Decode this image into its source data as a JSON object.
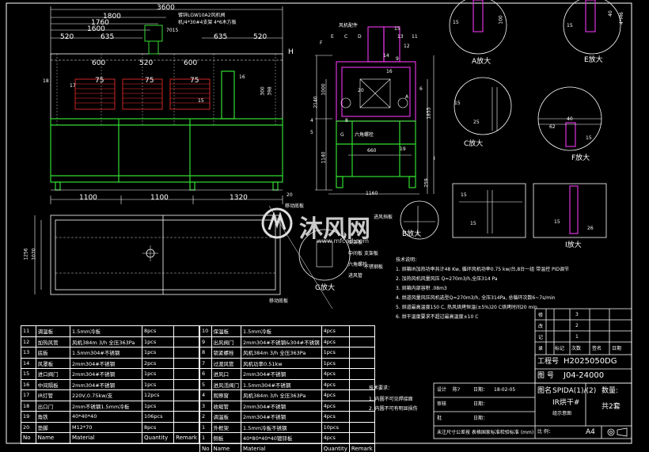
{
  "watermark": {
    "brand": "沐风网",
    "url": "www.mfcad.com"
  },
  "front_view": {
    "dims": [
      "3600",
      "1800",
      "1760",
      "1600",
      "520",
      "635",
      "635",
      "520",
      "600",
      "520",
      "600",
      "75",
      "75",
      "75",
      "300",
      "398",
      "1100",
      "1100",
      "1320",
      "17",
      "18",
      "15",
      "16",
      "H",
      "20"
    ],
    "callout": [
      "镀锌LGW10A2风机阀",
      "机/4*30#4支架",
      "4*6木方板"
    ],
    "callout_code": "7015"
  },
  "plan_view": {
    "dims": [
      "1256",
      "1070"
    ],
    "notes": [
      "移动底板",
      "支架板",
      "不锈钢板",
      "移动底板",
      "进风挡板"
    ]
  },
  "side_view": {
    "labels": [
      "E",
      "C",
      "D",
      "A",
      "F",
      "11",
      "12",
      "13",
      "14",
      "15",
      "16",
      "20",
      "6",
      "9",
      "4",
      "5",
      "G",
      "8",
      "19"
    ],
    "dims": [
      "1000",
      "2140",
      "1140",
      "1855",
      "660",
      "1160",
      "259",
      "I"
    ],
    "notes": [
      "风机配件",
      "六角螺栓"
    ]
  },
  "details": {
    "a": {
      "title": "A放大",
      "dims": [
        "15",
        "100"
      ]
    },
    "e": {
      "title": "E放大",
      "dims": [
        "15",
        "40",
        "4*M6"
      ]
    },
    "c": {
      "title": "C放大",
      "dims": [
        "15",
        "25"
      ]
    },
    "f": {
      "title": "F放大",
      "dims": [
        "62",
        "40",
        "15"
      ]
    },
    "b": {
      "title": "B放大"
    },
    "i": {
      "title": "I放大",
      "dims": [
        "15",
        "26"
      ]
    },
    "h": {
      "dims": [
        "15",
        "15"
      ]
    },
    "g": {
      "title": "G放大",
      "notes": [
        "支架板",
        "中间板",
        "六角螺栓",
        "进风管"
      ]
    }
  },
  "tech_req": {
    "title": "技术说明：",
    "items": [
      "1. 烘箱IR加热功率共计48   Kw, 循环风机功率0.75   kw/台,8台一组   带温控   PID调节",
      "2. 加热风机风量风压    Q=270m3/h,全压314 Pa",
      "3. 烘箱内部容积 .08m3",
      "4. 烘道风量风压风机选型Q=270m3/h,       全压314Pa,   总循环次数6~7s/min",
      "5. 烘道最高温度150   C, 热风烘烤恒温(±5%)20   C烘烤时间20   min",
      "6. 烘干温度要求不超过最高温度±10         C"
    ]
  },
  "bom_left": {
    "rows": [
      [
        "11",
        "调温板",
        "1.5mm冷板",
        "8pcs",
        ""
      ],
      [
        "12",
        "加热风管",
        "风机384m 3/h 全压363Pa",
        "1pcs",
        ""
      ],
      [
        "13",
        "底板",
        "1.5mm304#不锈钢",
        "1pcs",
        ""
      ],
      [
        "14",
        "风罩板",
        "2mm304#不锈钢",
        "2pcs",
        ""
      ],
      [
        "15",
        "进口阀门",
        "2mm304#不锈钢",
        "1pcs",
        ""
      ],
      [
        "16",
        "中间隔板",
        "2mm304#不锈钢",
        "1pcs",
        ""
      ],
      [
        "17",
        "IR灯管",
        "220V,0.75kw/支",
        "12pcs",
        ""
      ],
      [
        "18",
        "出口门",
        "2mm不锈钢1.5mm冷板",
        "1pcs",
        ""
      ],
      [
        "19",
        "角铁",
        "40*40*40",
        "106pcs",
        ""
      ],
      [
        "20",
        "垫脚",
        "M12*70",
        "8pcs",
        ""
      ]
    ],
    "header": [
      "No",
      "Name",
      "Material",
      "Quantity",
      "Remark"
    ]
  },
  "bom_right": {
    "rows": [
      [
        "10",
        "保温板",
        "1.5mm冷板",
        "4pcs",
        ""
      ],
      [
        "9",
        "出风阀门",
        "2mm304#不锈钢&304#不锈钢",
        "4pcs",
        ""
      ],
      [
        "8",
        "锁紧螺栓",
        "风机384m 3/h 全压363Pa",
        "1pcs",
        ""
      ],
      [
        "7",
        "过渡风管",
        "风机功率0.51kw",
        "1pcs",
        ""
      ],
      [
        "6",
        "进风口",
        "2mm304#不锈钢",
        "4pcs",
        ""
      ],
      [
        "5",
        "进风活阀门",
        "1.5mm304#不锈钢",
        "4pcs",
        ""
      ],
      [
        "4",
        "观察窗",
        "风机384m 3/h 全压363Pa",
        "4pcs",
        ""
      ],
      [
        "3",
        "收缩管",
        "2mm304#不锈钢",
        "4pcs",
        ""
      ],
      [
        "2",
        "调温板",
        "2mm304#不锈钢",
        "4pcs",
        ""
      ],
      [
        "1",
        "外框架",
        "1.5mm冷板不锈钢",
        "10pcs",
        ""
      ],
      [
        "1",
        "侧板",
        "40*80*40*40镀锌板",
        "4pcs",
        ""
      ]
    ],
    "header": [
      "No",
      "Name",
      "Material",
      "Quantity",
      "Remark"
    ]
  },
  "notes_block": {
    "title": "技术要求：",
    "items": [
      "1. 内圆不可见焊接面",
      "2. 内圆不可有明显损伤"
    ]
  },
  "title_block": {
    "rev_rows": [
      [
        "3",
        ""
      ],
      [
        "2",
        ""
      ],
      [
        "1",
        ""
      ]
    ],
    "rev_labels": [
      "修",
      "改",
      "记",
      "录"
    ],
    "rev_header": [
      "标记",
      "次数",
      "签名",
      "日期"
    ],
    "project_label": "工程号",
    "project_no": "H2025050DG",
    "drawing_label": "图  号",
    "drawing_no": "J04-24000",
    "design_label": "设计",
    "design_name": "陈?",
    "date_label": "日期：",
    "date": "18-02-05",
    "check_label": "审核",
    "approve_label": "批",
    "name_label": "图名",
    "name_value": "SPIDA(1)/(2)",
    "qty_label": "数量:",
    "subtitle": "IR烘干#",
    "subtitle2": "组示意图",
    "sheet": "共2套",
    "tolerance": "未注尺寸公差按   表格国家标准检验标准       (mm)",
    "scale_label": "比  例：",
    "paper": "A4"
  }
}
